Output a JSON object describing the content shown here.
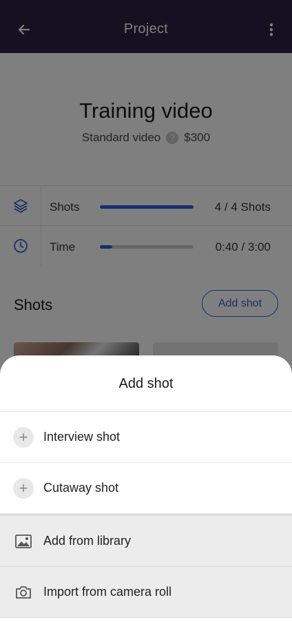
{
  "app_bar": {
    "title": "Project"
  },
  "project": {
    "name": "Training video",
    "type": "Standard video",
    "help": "?",
    "price": "$300"
  },
  "stats": [
    {
      "label": "Shots",
      "progress": 1.0,
      "value": "4 / 4 Shots"
    },
    {
      "label": "Time",
      "progress": 0.13,
      "value": "0:40 / 3:00"
    }
  ],
  "shots": {
    "heading": "Shots",
    "add_label": "Add shot"
  },
  "sheet": {
    "title": "Add shot",
    "options": [
      {
        "label": "Interview shot",
        "icon": "plus-icon"
      },
      {
        "label": "Cutaway shot",
        "icon": "plus-icon"
      },
      {
        "label": "Add from library",
        "icon": "image-icon"
      },
      {
        "label": "Import from camera roll",
        "icon": "camera-icon"
      }
    ]
  },
  "colors": {
    "appbar": "#2a2342",
    "accent": "#2b5cd6"
  }
}
